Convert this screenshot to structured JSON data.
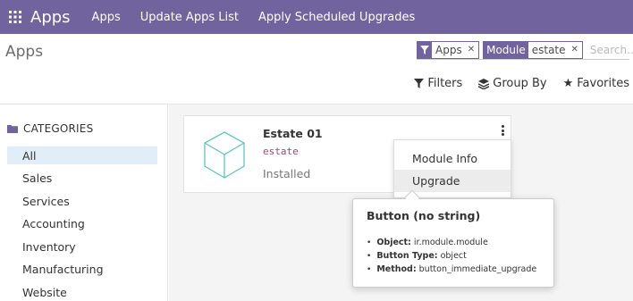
{
  "navbar": {
    "icon": "grid-icon",
    "brand": "Apps",
    "menu": [
      "Apps",
      "Update Apps List",
      "Apply Scheduled Upgrades"
    ],
    "bg_color": "#71639e"
  },
  "control_panel": {
    "title": "Apps",
    "search": {
      "facets": [
        {
          "icon": "filter-icon",
          "value": "Apps"
        },
        {
          "label": "Module",
          "value": "estate"
        }
      ],
      "placeholder": "Search..."
    },
    "buttons": {
      "filters": "Filters",
      "group_by": "Group By",
      "favorites": "Favorites"
    }
  },
  "sidebar": {
    "header": "CATEGORIES",
    "items": [
      "All",
      "Sales",
      "Services",
      "Accounting",
      "Inventory",
      "Manufacturing",
      "Website"
    ],
    "active": "All"
  },
  "card": {
    "icon": "cube-icon",
    "title": "Estate 01",
    "technical_name": "estate",
    "status": "Installed"
  },
  "dropdown": {
    "items": [
      "Module Info",
      "Upgrade"
    ],
    "hovered": "Upgrade"
  },
  "tooltip": {
    "title": "Button (no string)",
    "rows": [
      {
        "key": "Object:",
        "value": "ir.module.module"
      },
      {
        "key": "Button Type:",
        "value": "object"
      },
      {
        "key": "Method:",
        "value": "button_immediate_upgrade"
      }
    ]
  }
}
